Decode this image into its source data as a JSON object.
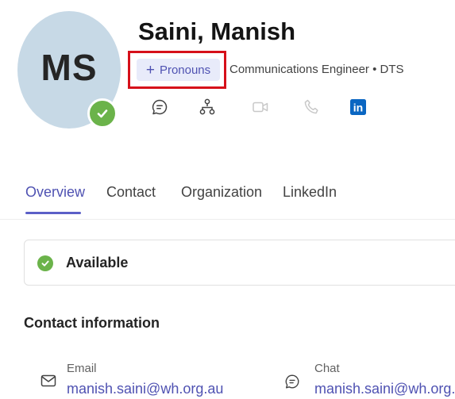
{
  "profile": {
    "initials": "MS",
    "name": "Saini, Manish",
    "pronouns_label": "Pronouns",
    "subtitle": "Communications Engineer • DTS",
    "presence_color": "#6bb34a"
  },
  "actions": [
    {
      "icon": "chat-icon"
    },
    {
      "icon": "org-chart-icon"
    },
    {
      "icon": "video-call-icon"
    },
    {
      "icon": "phone-call-icon"
    },
    {
      "icon": "linkedin-icon",
      "text": "in"
    }
  ],
  "tabs": [
    {
      "label": "Overview",
      "active": true
    },
    {
      "label": "Contact",
      "active": false
    },
    {
      "label": "Organization",
      "active": false
    },
    {
      "label": "LinkedIn",
      "active": false
    }
  ],
  "status": {
    "label": "Available"
  },
  "contact_section": {
    "title": "Contact information",
    "email": {
      "label": "Email",
      "value": "manish.saini@wh.org.au"
    },
    "chat": {
      "label": "Chat",
      "value": "manish.saini@wh.org.au"
    }
  },
  "colors": {
    "accent": "#5b5fc7",
    "highlight_box": "#d6101a",
    "linkedin": "#0a66c2"
  }
}
